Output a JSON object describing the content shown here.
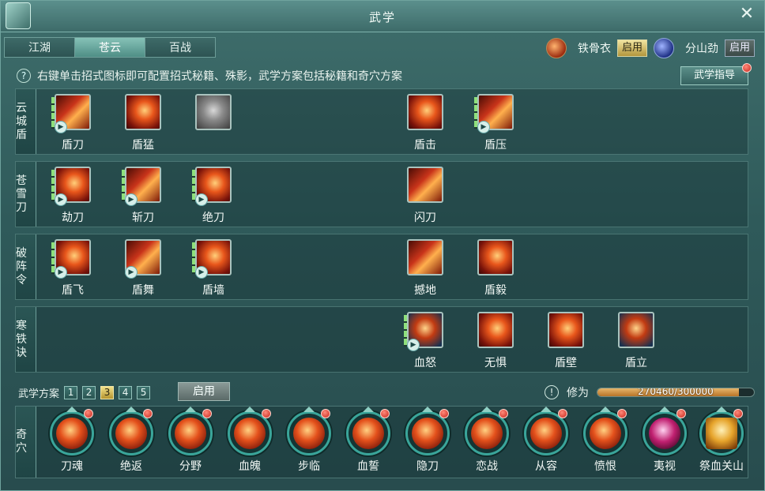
{
  "window": {
    "title": "武学",
    "close_symbol": "✕"
  },
  "tabs": [
    {
      "label": "江湖"
    },
    {
      "label": "苍云"
    },
    {
      "label": "百战"
    }
  ],
  "toggles": [
    {
      "label": "铁骨衣",
      "button": "启用",
      "icon": "shield-emblem-icon"
    },
    {
      "label": "分山劲",
      "button": "启用",
      "icon": "blade-emblem-icon"
    }
  ],
  "info": {
    "text": "右键单击招式图标即可配置招式秘籍、殊影，武学方案包括秘籍和奇穴方案",
    "help_symbol": "?"
  },
  "guide_button": "武学指导",
  "rows": [
    {
      "label": "云城盾",
      "skills": [
        {
          "name": "盾刀"
        },
        {
          "name": "盾猛"
        },
        {
          "name": ""
        },
        {
          "name": "盾击"
        },
        {
          "name": "盾压"
        }
      ]
    },
    {
      "label": "苍雪刀",
      "skills": [
        {
          "name": "劫刀"
        },
        {
          "name": "斩刀"
        },
        {
          "name": "绝刀"
        },
        {
          "name": "闪刀"
        }
      ]
    },
    {
      "label": "破阵令",
      "skills": [
        {
          "name": "盾飞"
        },
        {
          "name": "盾舞"
        },
        {
          "name": "盾墙"
        },
        {
          "name": "撼地"
        },
        {
          "name": "盾毅"
        }
      ]
    },
    {
      "label": "寒铁诀",
      "skills": [
        {
          "name": "血怒"
        },
        {
          "name": "无惧"
        },
        {
          "name": "盾壁"
        },
        {
          "name": "盾立"
        }
      ]
    }
  ],
  "plans": {
    "label": "武学方案",
    "numbers": [
      "1",
      "2",
      "3",
      "4",
      "5"
    ],
    "selected": "3",
    "enable_button": "启用"
  },
  "cultivation": {
    "label": "修为",
    "current": 270460,
    "max": 300000,
    "text": "270460/300000",
    "alert_symbol": "!"
  },
  "qixue": {
    "label": "奇穴",
    "items": [
      {
        "name": "刀魂"
      },
      {
        "name": "绝返"
      },
      {
        "name": "分野"
      },
      {
        "name": "血魄"
      },
      {
        "name": "步临"
      },
      {
        "name": "血誓"
      },
      {
        "name": "隐刀"
      },
      {
        "name": "恋战"
      },
      {
        "name": "从容"
      },
      {
        "name": "愤恨"
      },
      {
        "name": "夷视"
      },
      {
        "name": "祭血关山"
      }
    ]
  }
}
